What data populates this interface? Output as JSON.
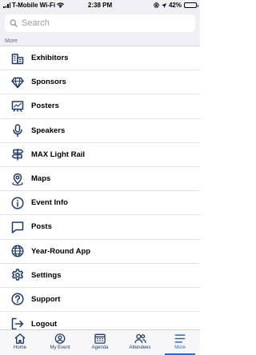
{
  "status_bar": {
    "carrier": "T-Mobile Wi-Fi",
    "time": "2:38 PM",
    "battery": "42%",
    "battery_level": 0.42
  },
  "search": {
    "placeholder": "Search",
    "icon": "search-icon"
  },
  "section": {
    "title": "More"
  },
  "menu": {
    "items": [
      {
        "label": "Exhibitors",
        "icon": "building-icon"
      },
      {
        "label": "Sponsors",
        "icon": "diamond-icon"
      },
      {
        "label": "Posters",
        "icon": "presentation-board-icon"
      },
      {
        "label": "Speakers",
        "icon": "microphone-icon"
      },
      {
        "label": "MAX Light Rail",
        "icon": "signpost-icon"
      },
      {
        "label": "Maps",
        "icon": "map-pin-icon"
      },
      {
        "label": "Event Info",
        "icon": "info-icon"
      },
      {
        "label": "Posts",
        "icon": "speech-bubble-icon"
      },
      {
        "label": "Year-Round App",
        "icon": "globe-icon"
      },
      {
        "label": "Settings",
        "icon": "gear-icon"
      },
      {
        "label": "Support",
        "icon": "question-icon"
      },
      {
        "label": "Logout",
        "icon": "logout-icon"
      }
    ]
  },
  "tab_bar": {
    "tabs": [
      {
        "label": "Home",
        "icon": "home-icon"
      },
      {
        "label": "My Event",
        "icon": "person-circle-icon"
      },
      {
        "label": "Agenda",
        "icon": "calendar-icon"
      },
      {
        "label": "Attendees",
        "icon": "people-icon"
      },
      {
        "label": "More",
        "icon": "menu-lines-icon",
        "active": true
      }
    ]
  },
  "colors": {
    "icon": "#1f3b6b",
    "accent": "#2d68c4",
    "header_bg": "#efeff4"
  }
}
